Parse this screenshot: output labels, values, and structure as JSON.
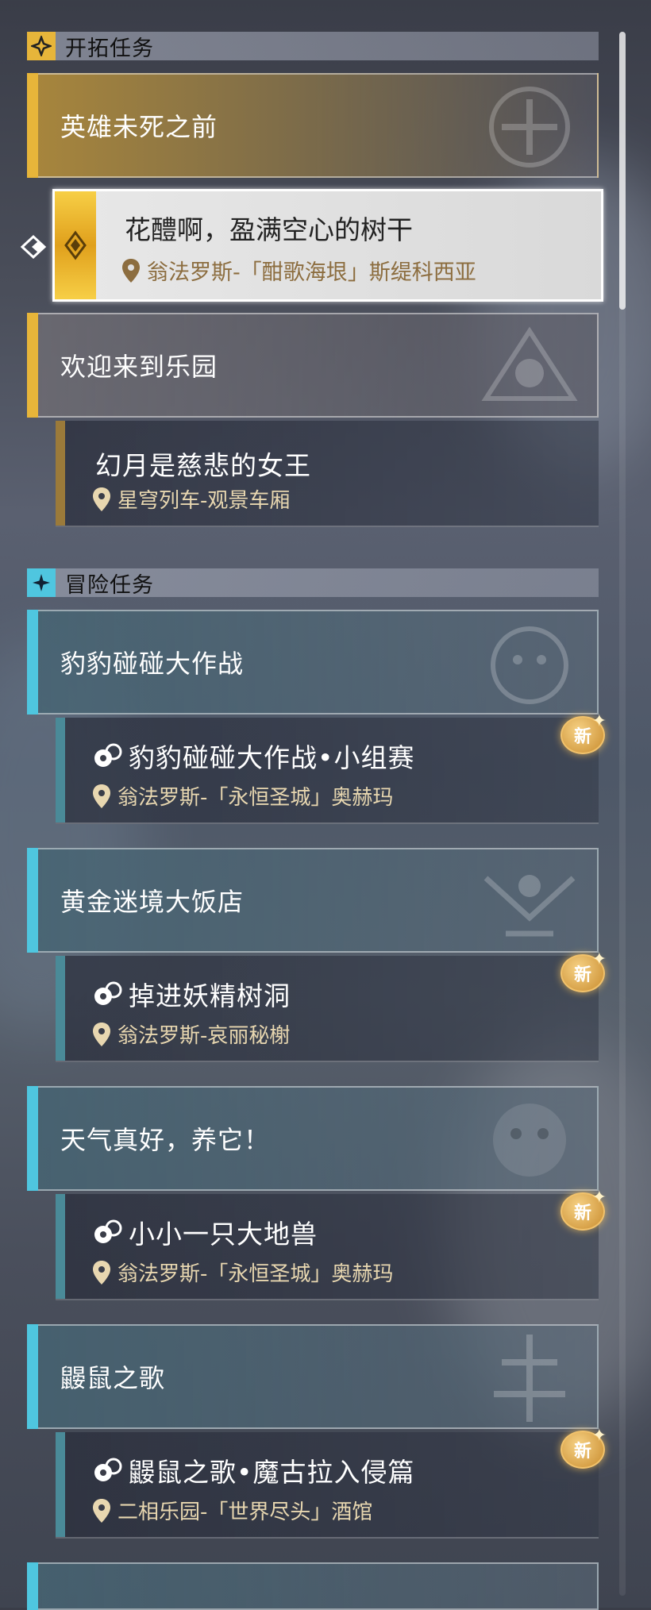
{
  "colors": {
    "trailblaze": "#e7b53a",
    "adventure": "#4fc6df",
    "location_text": "#e8d7b0",
    "new_badge": "#e6a940"
  },
  "sections": {
    "trailblaze": {
      "title": "开拓任务",
      "icon": "trailblaze-icon"
    },
    "adventure": {
      "title": "冒险任务",
      "icon": "adventure-icon"
    }
  },
  "groups": [
    {
      "title": "英雄未死之前"
    },
    {
      "title": "欢迎来到乐园"
    },
    {
      "title": "豹豹碰碰大作战"
    },
    {
      "title": "黄金迷境大饭店"
    },
    {
      "title": "天气真好，养它！"
    },
    {
      "title": "鼹鼠之歌"
    }
  ],
  "quests": [
    {
      "title": "花醴啊，盈满空心的树干",
      "location": "翁法罗斯-「酣歌海垠」斯缇科西亚",
      "selected": true
    },
    {
      "title": "幻月是慈悲的女王",
      "location": "星穹列车-观景车厢"
    },
    {
      "title": "豹豹碰碰大作战•小组赛",
      "location": "翁法罗斯-「永恒圣城」奥赫玛",
      "badge": "新"
    },
    {
      "title": "掉进妖精树洞",
      "location": "翁法罗斯-哀丽秘榭",
      "badge": "新"
    },
    {
      "title": "小小一只大地兽",
      "location": "翁法罗斯-「永恒圣城」奥赫玛",
      "badge": "新"
    },
    {
      "title": "鼹鼠之歌•魔古拉入侵篇",
      "location": "二相乐园-「世界尽头」酒馆",
      "badge": "新"
    }
  ]
}
